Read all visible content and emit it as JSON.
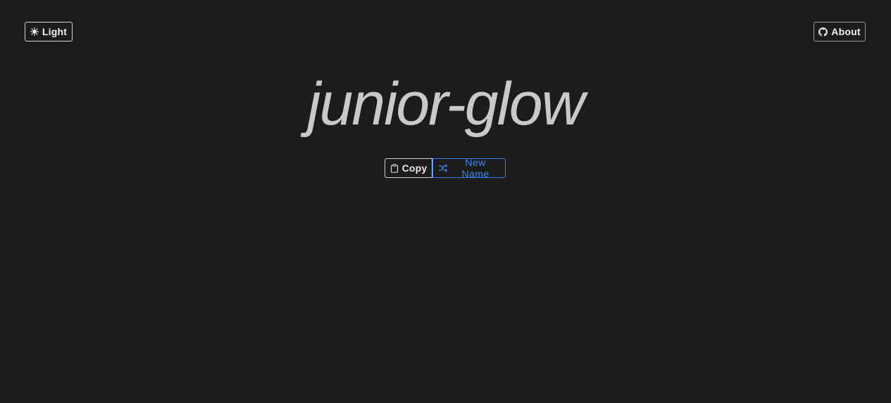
{
  "header": {
    "theme_toggle_label": "Light",
    "about_label": "About"
  },
  "main": {
    "generated_name": "junior-glow",
    "copy_label": "Copy",
    "new_name_label": "New Name"
  },
  "colors": {
    "background": "#1c1c1c",
    "name_text": "#c9c9c9",
    "accent": "#2f7ef0"
  },
  "icons": {
    "theme_toggle": "sun-icon",
    "about": "github-icon",
    "copy": "clipboard-icon",
    "new_name": "shuffle-icon"
  }
}
